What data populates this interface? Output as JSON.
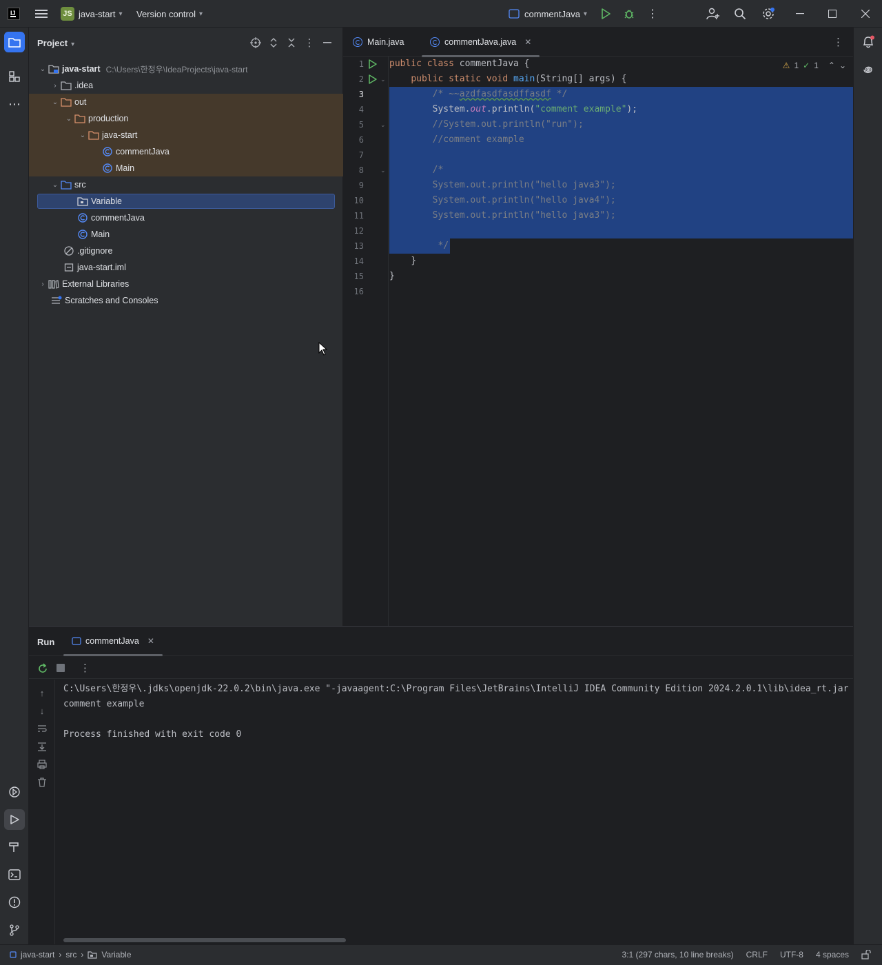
{
  "titlebar": {
    "project_badge": "JS",
    "project_name": "java-start",
    "vcs_label": "Version control",
    "run_config": "commentJava"
  },
  "project_panel": {
    "title": "Project",
    "root_name": "java-start",
    "root_path": "C:\\Users\\한정우\\IdeaProjects\\java-start",
    "items": [
      {
        "label": ".idea"
      },
      {
        "label": "out"
      },
      {
        "label": "production"
      },
      {
        "label": "java-start"
      },
      {
        "label": "commentJava"
      },
      {
        "label": "Main"
      },
      {
        "label": "src"
      },
      {
        "label": "Variable"
      },
      {
        "label": "commentJava"
      },
      {
        "label": "Main"
      },
      {
        "label": ".gitignore"
      },
      {
        "label": "java-start.iml"
      },
      {
        "label": "External Libraries"
      },
      {
        "label": "Scratches and Consoles"
      }
    ]
  },
  "editor": {
    "tabs": [
      {
        "label": "Main.java"
      },
      {
        "label": "commentJava.java"
      }
    ],
    "inspection": {
      "warnings": "1",
      "checks": "1"
    },
    "line_numbers": [
      "1",
      "2",
      "3",
      "4",
      "5",
      "6",
      "7",
      "8",
      "9",
      "10",
      "11",
      "12",
      "13",
      "14",
      "15",
      "16"
    ],
    "code": {
      "l1_kw": "public class ",
      "l1_name": "commentJava {",
      "l2_kw": "public static void ",
      "l2_fn": "main",
      "l2_rest": "(String[] args) {",
      "l3_open": "/* ~~",
      "l3_typo": "azdfasdfasdffasdf",
      "l3_close": " */",
      "l4_a": "System.",
      "l4_out": "out",
      "l4_b": ".println(",
      "l4_str": "\"comment example\"",
      "l4_c": ");",
      "l5": "//System.out.println(\"run\");",
      "l6": "//comment example",
      "l8": "/*",
      "l9": "System.out.println(\"hello java3\");",
      "l10": "System.out.println(\"hello java4\");",
      "l11": "System.out.println(\"hello java3\");",
      "l13": "*/",
      "l14": "}",
      "l15": "}"
    }
  },
  "run_panel": {
    "title": "Run",
    "tab_label": "commentJava",
    "console": [
      "C:\\Users\\한정우\\.jdks\\openjdk-22.0.2\\bin\\java.exe \"-javaagent:C:\\Program Files\\JetBrains\\IntelliJ IDEA Community Edition 2024.2.0.1\\lib\\idea_rt.jar",
      "comment example",
      "",
      "Process finished with exit code 0"
    ]
  },
  "statusbar": {
    "crumb1": "java-start",
    "crumb2": "src",
    "crumb3": "Variable",
    "position": "3:1 (297 chars, 10 line breaks)",
    "line_sep": "CRLF",
    "encoding": "UTF-8",
    "indent": "4 spaces"
  },
  "colors": {
    "accent": "#3574f0",
    "selection": "#214283",
    "excluded": "#45392b",
    "keyword": "#cf8e6d",
    "string": "#6aab73",
    "comment": "#7a7e85"
  }
}
